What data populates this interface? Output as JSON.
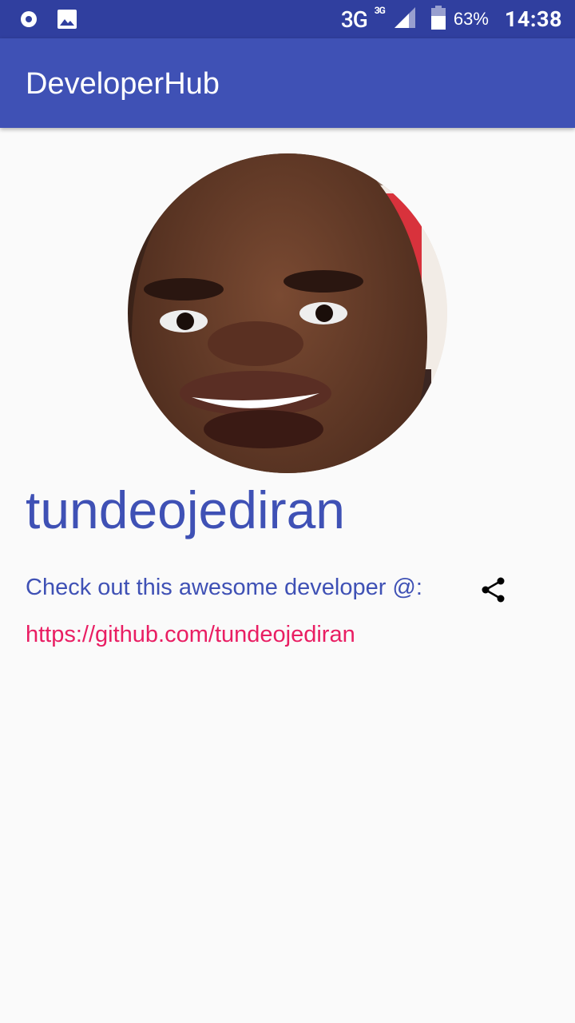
{
  "status_bar": {
    "network": "3G",
    "network_sup": "3G",
    "battery": "63%",
    "time": "14:38",
    "icons": [
      "media-icon",
      "gallery-icon",
      "signal-icon",
      "battery-icon"
    ]
  },
  "app_bar": {
    "title": "DeveloperHub"
  },
  "profile": {
    "username": "tundeojediran",
    "promo_text": "Check out this awesome developer @:",
    "profile_url": "https://github.com/tundeojediran",
    "share_icon": "share-icon"
  },
  "colors": {
    "status_bar": "#303f9f",
    "primary": "#3f51b5",
    "accent": "#e91e63",
    "background": "#fafafa"
  }
}
